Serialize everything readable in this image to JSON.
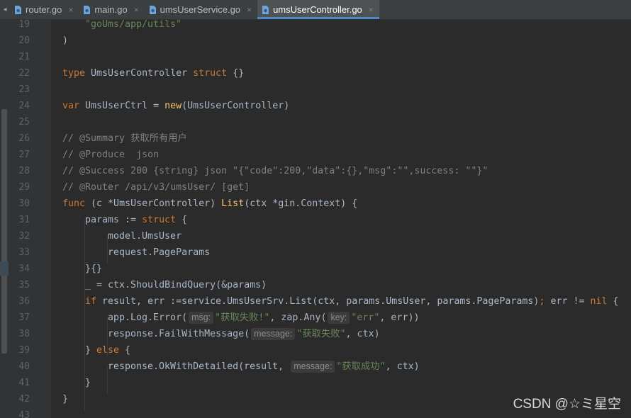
{
  "tabs": [
    {
      "label": "router.go",
      "active": false
    },
    {
      "label": "main.go",
      "active": false
    },
    {
      "label": "umsUserService.go",
      "active": false
    },
    {
      "label": "umsUserController.go",
      "active": true
    }
  ],
  "tab_close": "×",
  "line_numbers": [
    "19",
    "20",
    "21",
    "22",
    "23",
    "24",
    "25",
    "26",
    "27",
    "28",
    "29",
    "30",
    "31",
    "32",
    "33",
    "34",
    "35",
    "36",
    "37",
    "38",
    "39",
    "40",
    "41",
    "42",
    "43"
  ],
  "code": {
    "l19_str": "\"goUms/app/utils\"",
    "l20": ")",
    "l22_kw1": "type",
    "l22_name": " UmsUserController ",
    "l22_kw2": "struct",
    "l22_rest": " {}",
    "l24_kw": "var",
    "l24_name": " UmsUserCtrl = ",
    "l24_fn": "new",
    "l24_rest": "(UmsUserController)",
    "l26": "// @Summary 获取所有用户",
    "l27": "// @Produce  json",
    "l28": "// @Success 200 {string} json \"{\"code\":200,\"data\":{},\"msg\":\"\",success: \"\"}\"",
    "l29": "// @Router /api/v3/umsUser/ [get]",
    "l30_kw": "func",
    "l30_a": " (c *UmsUserController) ",
    "l30_fn": "List",
    "l30_b": "(ctx *gin.Context) {",
    "l31_a": "params := ",
    "l31_kw": "struct",
    "l31_b": " {",
    "l32": "model.UmsUser",
    "l33": "request.PageParams",
    "l34": "}{}",
    "l35": "_ = ctx.ShouldBindQuery(&params)",
    "l36_kw": "if",
    "l36_a": " result, err :=service.UmsUserSrv.List(ctx, params.UmsUser, params.PageParams)",
    "l36_semi": ";",
    "l36_b": " err != ",
    "l36_nil": "nil",
    "l36_c": " {",
    "l37_a": "app.Log.Error(",
    "l37_hint1": "msg:",
    "l37_str1": "\"获取失败!\"",
    "l37_b": ", zap.Any(",
    "l37_hint2": "key:",
    "l37_str2": "\"err\"",
    "l37_c": ", err))",
    "l38_a": "response.FailWithMessage(",
    "l38_hint": "message:",
    "l38_str": "\"获取失败\"",
    "l38_b": ", ctx)",
    "l39_a": "} ",
    "l39_kw": "else",
    "l39_b": " {",
    "l40_a": "response.OkWithDetailed(result, ",
    "l40_hint": "message:",
    "l40_str": "\"获取成功\"",
    "l40_b": ", ctx)",
    "l41": "}",
    "l42": "}"
  },
  "watermark": "CSDN @☆ミ星空"
}
